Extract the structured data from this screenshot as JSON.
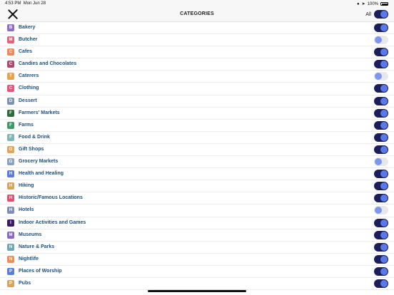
{
  "status": {
    "time": "4:53 PM",
    "date": "Mon Jun 28",
    "battery": "100%"
  },
  "header": {
    "title": "CATEGORIES",
    "all_label": "All",
    "all_on": true
  },
  "categories": [
    {
      "label": "Bakery",
      "on": true,
      "icon": "bread-icon",
      "color": "#8b6fc9",
      "glyph": "B"
    },
    {
      "label": "Butcher",
      "on": false,
      "icon": "meat-icon",
      "color": "#e0647a",
      "glyph": "M"
    },
    {
      "label": "Cafes",
      "on": true,
      "icon": "coffee-icon",
      "color": "#f08a5a",
      "glyph": "C"
    },
    {
      "label": "Candies and Chocolates",
      "on": true,
      "icon": "candy-icon",
      "color": "#b04a72",
      "glyph": "C"
    },
    {
      "label": "Caterers",
      "on": false,
      "icon": "catering-icon",
      "color": "#e7a24a",
      "glyph": "T"
    },
    {
      "label": "Clothing",
      "on": true,
      "icon": "clothing-icon",
      "color": "#e9557a",
      "glyph": "C"
    },
    {
      "label": "Dessert",
      "on": true,
      "icon": "dessert-icon",
      "color": "#7d94b5",
      "glyph": "D"
    },
    {
      "label": "Farmers' Markets",
      "on": true,
      "icon": "market-stand-icon",
      "color": "#2f6a3c",
      "glyph": "F"
    },
    {
      "label": "Farms",
      "on": true,
      "icon": "barn-icon",
      "color": "#3f9a69",
      "glyph": "F"
    },
    {
      "label": "Food & Drink",
      "on": true,
      "icon": "food-drink-icon",
      "color": "#7fb6b2",
      "glyph": "F"
    },
    {
      "label": "Gift Shops",
      "on": true,
      "icon": "gift-icon",
      "color": "#e3a55a",
      "glyph": "G"
    },
    {
      "label": "Grocery Markets",
      "on": false,
      "icon": "grocery-icon",
      "color": "#8ba3c2",
      "glyph": "G"
    },
    {
      "label": "Health and Healing",
      "on": true,
      "icon": "health-icon",
      "color": "#5b7be0",
      "glyph": "H"
    },
    {
      "label": "Hiking",
      "on": true,
      "icon": "hiking-icon",
      "color": "#d8a25f",
      "glyph": "H"
    },
    {
      "label": "Historic/Famous Locations",
      "on": true,
      "icon": "landmark-icon",
      "color": "#e4506e",
      "glyph": "H"
    },
    {
      "label": "Hotels",
      "on": false,
      "icon": "hotel-icon",
      "color": "#7d8fb6",
      "glyph": "H"
    },
    {
      "label": "Indoor Activities and Games",
      "on": true,
      "icon": "game-icon",
      "color": "#3a1a6a",
      "glyph": "I"
    },
    {
      "label": "Museums",
      "on": true,
      "icon": "museum-icon",
      "color": "#8a68c4",
      "glyph": "M"
    },
    {
      "label": "Nature & Parks",
      "on": true,
      "icon": "nature-icon",
      "color": "#6fa7b5",
      "glyph": "N"
    },
    {
      "label": "Nightlife",
      "on": true,
      "icon": "nightlife-icon",
      "color": "#ef8f55",
      "glyph": "N"
    },
    {
      "label": "Places of Worship",
      "on": true,
      "icon": "worship-icon",
      "color": "#5b7ed8",
      "glyph": "P"
    },
    {
      "label": "Pubs",
      "on": true,
      "icon": "pub-icon",
      "color": "#d7a35e",
      "glyph": "P"
    }
  ]
}
